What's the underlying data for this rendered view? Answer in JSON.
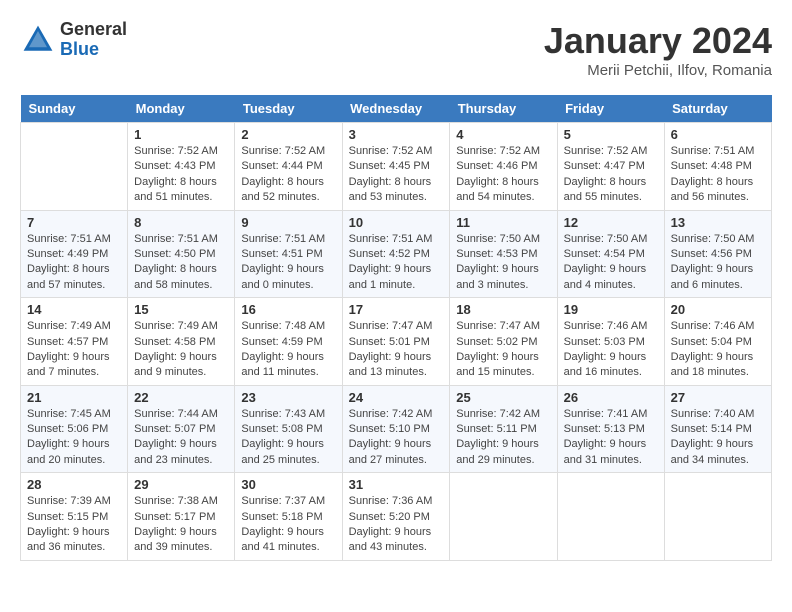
{
  "header": {
    "logo": {
      "general": "General",
      "blue": "Blue"
    },
    "title": "January 2024",
    "location": "Merii Petchii, Ilfov, Romania"
  },
  "weekdays": [
    "Sunday",
    "Monday",
    "Tuesday",
    "Wednesday",
    "Thursday",
    "Friday",
    "Saturday"
  ],
  "weeks": [
    [
      {
        "day": "",
        "info": ""
      },
      {
        "day": "1",
        "info": "Sunrise: 7:52 AM\nSunset: 4:43 PM\nDaylight: 8 hours\nand 51 minutes."
      },
      {
        "day": "2",
        "info": "Sunrise: 7:52 AM\nSunset: 4:44 PM\nDaylight: 8 hours\nand 52 minutes."
      },
      {
        "day": "3",
        "info": "Sunrise: 7:52 AM\nSunset: 4:45 PM\nDaylight: 8 hours\nand 53 minutes."
      },
      {
        "day": "4",
        "info": "Sunrise: 7:52 AM\nSunset: 4:46 PM\nDaylight: 8 hours\nand 54 minutes."
      },
      {
        "day": "5",
        "info": "Sunrise: 7:52 AM\nSunset: 4:47 PM\nDaylight: 8 hours\nand 55 minutes."
      },
      {
        "day": "6",
        "info": "Sunrise: 7:51 AM\nSunset: 4:48 PM\nDaylight: 8 hours\nand 56 minutes."
      }
    ],
    [
      {
        "day": "7",
        "info": "Sunrise: 7:51 AM\nSunset: 4:49 PM\nDaylight: 8 hours\nand 57 minutes."
      },
      {
        "day": "8",
        "info": "Sunrise: 7:51 AM\nSunset: 4:50 PM\nDaylight: 8 hours\nand 58 minutes."
      },
      {
        "day": "9",
        "info": "Sunrise: 7:51 AM\nSunset: 4:51 PM\nDaylight: 9 hours\nand 0 minutes."
      },
      {
        "day": "10",
        "info": "Sunrise: 7:51 AM\nSunset: 4:52 PM\nDaylight: 9 hours\nand 1 minute."
      },
      {
        "day": "11",
        "info": "Sunrise: 7:50 AM\nSunset: 4:53 PM\nDaylight: 9 hours\nand 3 minutes."
      },
      {
        "day": "12",
        "info": "Sunrise: 7:50 AM\nSunset: 4:54 PM\nDaylight: 9 hours\nand 4 minutes."
      },
      {
        "day": "13",
        "info": "Sunrise: 7:50 AM\nSunset: 4:56 PM\nDaylight: 9 hours\nand 6 minutes."
      }
    ],
    [
      {
        "day": "14",
        "info": "Sunrise: 7:49 AM\nSunset: 4:57 PM\nDaylight: 9 hours\nand 7 minutes."
      },
      {
        "day": "15",
        "info": "Sunrise: 7:49 AM\nSunset: 4:58 PM\nDaylight: 9 hours\nand 9 minutes."
      },
      {
        "day": "16",
        "info": "Sunrise: 7:48 AM\nSunset: 4:59 PM\nDaylight: 9 hours\nand 11 minutes."
      },
      {
        "day": "17",
        "info": "Sunrise: 7:47 AM\nSunset: 5:01 PM\nDaylight: 9 hours\nand 13 minutes."
      },
      {
        "day": "18",
        "info": "Sunrise: 7:47 AM\nSunset: 5:02 PM\nDaylight: 9 hours\nand 15 minutes."
      },
      {
        "day": "19",
        "info": "Sunrise: 7:46 AM\nSunset: 5:03 PM\nDaylight: 9 hours\nand 16 minutes."
      },
      {
        "day": "20",
        "info": "Sunrise: 7:46 AM\nSunset: 5:04 PM\nDaylight: 9 hours\nand 18 minutes."
      }
    ],
    [
      {
        "day": "21",
        "info": "Sunrise: 7:45 AM\nSunset: 5:06 PM\nDaylight: 9 hours\nand 20 minutes."
      },
      {
        "day": "22",
        "info": "Sunrise: 7:44 AM\nSunset: 5:07 PM\nDaylight: 9 hours\nand 23 minutes."
      },
      {
        "day": "23",
        "info": "Sunrise: 7:43 AM\nSunset: 5:08 PM\nDaylight: 9 hours\nand 25 minutes."
      },
      {
        "day": "24",
        "info": "Sunrise: 7:42 AM\nSunset: 5:10 PM\nDaylight: 9 hours\nand 27 minutes."
      },
      {
        "day": "25",
        "info": "Sunrise: 7:42 AM\nSunset: 5:11 PM\nDaylight: 9 hours\nand 29 minutes."
      },
      {
        "day": "26",
        "info": "Sunrise: 7:41 AM\nSunset: 5:13 PM\nDaylight: 9 hours\nand 31 minutes."
      },
      {
        "day": "27",
        "info": "Sunrise: 7:40 AM\nSunset: 5:14 PM\nDaylight: 9 hours\nand 34 minutes."
      }
    ],
    [
      {
        "day": "28",
        "info": "Sunrise: 7:39 AM\nSunset: 5:15 PM\nDaylight: 9 hours\nand 36 minutes."
      },
      {
        "day": "29",
        "info": "Sunrise: 7:38 AM\nSunset: 5:17 PM\nDaylight: 9 hours\nand 39 minutes."
      },
      {
        "day": "30",
        "info": "Sunrise: 7:37 AM\nSunset: 5:18 PM\nDaylight: 9 hours\nand 41 minutes."
      },
      {
        "day": "31",
        "info": "Sunrise: 7:36 AM\nSunset: 5:20 PM\nDaylight: 9 hours\nand 43 minutes."
      },
      {
        "day": "",
        "info": ""
      },
      {
        "day": "",
        "info": ""
      },
      {
        "day": "",
        "info": ""
      }
    ]
  ]
}
